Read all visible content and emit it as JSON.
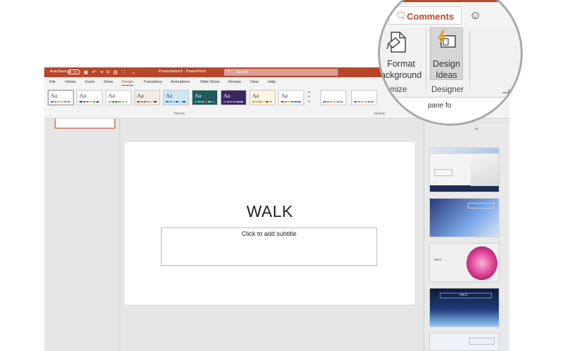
{
  "titlebar": {
    "autosave_label": "AutoSave",
    "autosave_state": "Off",
    "document_title": "Presentation3 - PowerPoint",
    "search_placeholder": "Search",
    "icons": [
      "save-icon",
      "undo-icon",
      "redo-icon",
      "customize-icon"
    ]
  },
  "tabs": [
    "File",
    "Home",
    "Insert",
    "Draw",
    "Design",
    "Transitions",
    "Animations",
    "Slide Show",
    "Review",
    "View",
    "Help"
  ],
  "active_tab": "Design",
  "ribbon": {
    "themes_label": "Themes",
    "variants_label": "Variants",
    "theme_sample": "Aa",
    "themes_count": 9,
    "themes": [
      {
        "bg": "#ffffff",
        "swatch": [
          "#4472c4",
          "#ed7d31",
          "#a5a5a5",
          "#ffc000",
          "#5b9bd5",
          "#70ad47"
        ]
      },
      {
        "bg": "#ffffff",
        "swatch": [
          "#1f3864",
          "#2e75b6",
          "#c55a11",
          "#ffc000",
          "#70ad47",
          "#7030a0"
        ]
      },
      {
        "bg": "#ffffff",
        "swatch": [
          "#8cc63f",
          "#4d8a2f",
          "#2e6b2a",
          "#6aa842",
          "#a3cd62",
          "#bbd785"
        ]
      },
      {
        "bg": "#f2ece4",
        "swatch": [
          "#a3553a",
          "#c77c4e",
          "#8d7062",
          "#b39b8a",
          "#d9c5a5",
          "#5c4033"
        ]
      },
      {
        "bg": "#cfe6f5",
        "swatch": [
          "#2f80c1",
          "#4aa3df",
          "#6fb9ea",
          "#2565a0",
          "#98cdf0",
          "#1c4f7f"
        ]
      },
      {
        "bg": "#1d5b5e",
        "swatch": [
          "#2eb3aa",
          "#5fcfc6",
          "#f5b041",
          "#e74c3c",
          "#a0d995",
          "#3c8dad"
        ]
      },
      {
        "bg": "#3b2760",
        "swatch": [
          "#8e63c9",
          "#b18be3",
          "#e37bae",
          "#5e9de0",
          "#f0c35d",
          "#9ad0c2"
        ]
      },
      {
        "bg": "#fff5e4",
        "swatch": [
          "#c9a227",
          "#e0b84b",
          "#a67c2b",
          "#f1d27d",
          "#7a5c1b",
          "#d8a657"
        ]
      },
      {
        "bg": "#ffffff",
        "swatch": [
          "#c0392b",
          "#e67e22",
          "#f1c40f",
          "#27ae60",
          "#2980b9",
          "#8e44ad"
        ]
      }
    ],
    "variants": [
      {
        "swatch": [
          "#4472c4",
          "#ed7d31",
          "#a5a5a5",
          "#ffc000",
          "#5b9bd5",
          "#70ad47"
        ]
      },
      {
        "swatch": [
          "#4472c4",
          "#ed7d31",
          "#a5a5a5",
          "#ffc000",
          "#5b9bd5",
          "#70ad47"
        ]
      }
    ]
  },
  "slide": {
    "title": "WALK",
    "subtitle_placeholder": "Click to add subtitle"
  },
  "designer_pane": {
    "partial_text": "pane for",
    "partial_text_2": "es.",
    "card_colors": [
      "#dce6f5",
      "#f4f4f4",
      "#2b3d78",
      "#f2f2f2",
      "#0c1a3a",
      "#eef2f6"
    ]
  },
  "magnifier": {
    "comments_label": "Comments",
    "format_background_label": "Format Background",
    "format_background_lines": [
      "Format",
      "ackground"
    ],
    "design_ideas_lines": [
      "Design",
      "Ideas"
    ],
    "customize_group_label": "mize",
    "designer_group_label": "Designer",
    "pane_text": "pane fo",
    "colors": {
      "accent": "#b7472a",
      "ribbon_bg": "#f1f1f1"
    }
  },
  "colors": {
    "accent": "#b7472a",
    "window_bg": "#e6e6e6"
  }
}
